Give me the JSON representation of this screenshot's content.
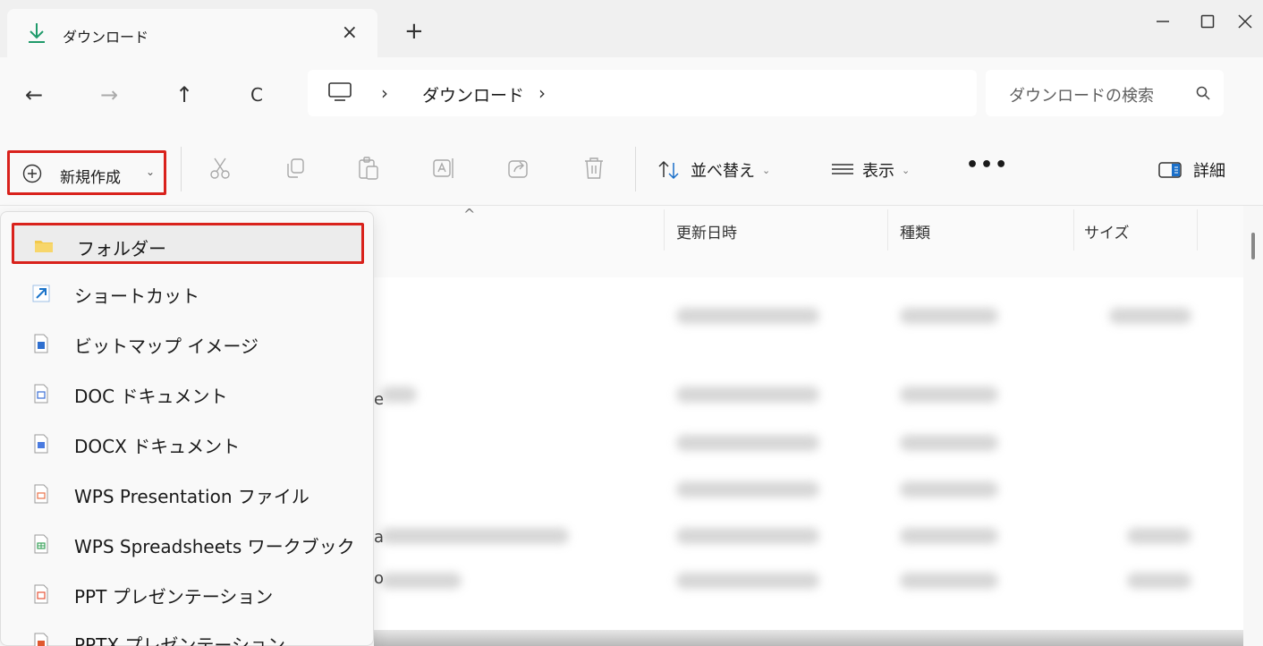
{
  "window": {
    "tab_title": "ダウンロード",
    "tab_close": "×",
    "new_tab": "+",
    "minimize": "—",
    "close": "✕"
  },
  "nav": {
    "back": "←",
    "forward": "→",
    "up": "↑",
    "refresh": "C",
    "separator": "›",
    "breadcrumb": "ダウンロード",
    "search_placeholder": "ダウンロードの検索"
  },
  "toolbar": {
    "new_label": "新規作成",
    "sort_label": "並べ替え",
    "view_label": "表示",
    "more_label": "•••",
    "details_label": "詳細",
    "chevron": "⌄"
  },
  "columns": {
    "modified": "更新日時",
    "type": "種類",
    "size": "サイズ",
    "sort_caret": "^"
  },
  "menu": {
    "items": [
      {
        "label": "フォルダー",
        "icon": "folder-icon",
        "color": "#f2c94c"
      },
      {
        "label": "ショートカット",
        "icon": "shortcut-icon",
        "color": "#1a73c9"
      },
      {
        "label": "ビットマップ イメージ",
        "icon": "bitmap-image-icon",
        "color": "#2f6fcf"
      },
      {
        "label": "DOC ドキュメント",
        "icon": "doc-file-icon",
        "color": "#3b6fd4"
      },
      {
        "label": "DOCX ドキュメント",
        "icon": "docx-file-icon",
        "color": "#4a7be0"
      },
      {
        "label": "WPS Presentation ファイル",
        "icon": "wps-presentation-icon",
        "color": "#e8734a"
      },
      {
        "label": "WPS Spreadsheets ワークブック",
        "icon": "wps-spreadsheet-icon",
        "color": "#3aa25a"
      },
      {
        "label": "PPT プレゼンテーション",
        "icon": "ppt-file-icon",
        "color": "#e5553a"
      },
      {
        "label": "PPTX プレゼンテーション",
        "icon": "pptx-file-icon",
        "color": "#e0592f"
      }
    ]
  },
  "peek": {
    "row1": "e",
    "row2": "a",
    "row3": "o"
  }
}
